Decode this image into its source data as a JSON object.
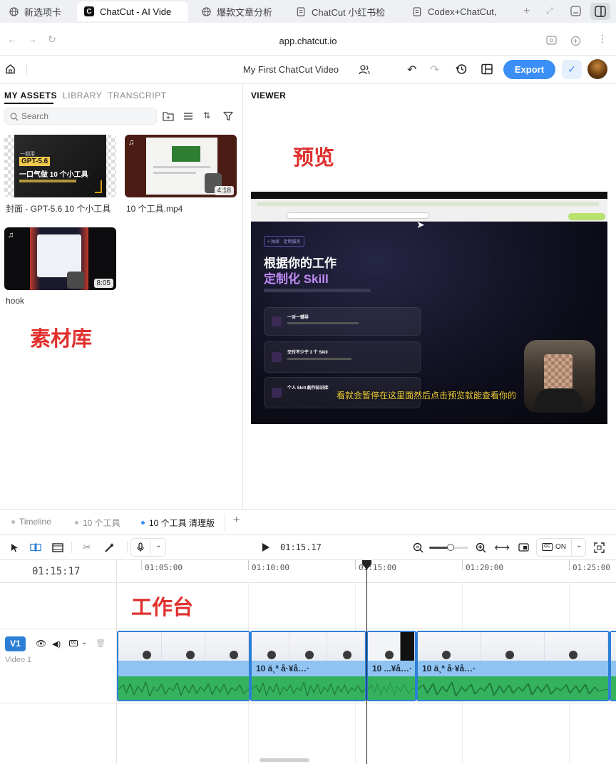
{
  "browser": {
    "tabs": [
      {
        "label": "新选项卡",
        "icon": "globe-icon"
      },
      {
        "label": "ChatCut - AI Vide",
        "icon": "chatcut-logo-icon"
      },
      {
        "label": "爆款文章分析",
        "icon": "globe-icon"
      },
      {
        "label": "ChatCut 小红书检",
        "icon": "document-icon"
      },
      {
        "label": "Codex+ChatCut,",
        "icon": "document-icon"
      }
    ],
    "url": "app.chatcut.io"
  },
  "app": {
    "project_title": "My First ChatCut Video",
    "export_label": "Export",
    "brand_color": "#3b8ef3"
  },
  "assets": {
    "tabs": [
      "MY ASSETS",
      "LIBRARY",
      "TRANSCRIPT"
    ],
    "search_placeholder": "Search",
    "items": [
      {
        "name": "封面 - GPT-5.6 10 个小工具",
        "overlay_title": "GPT-5.6",
        "overlay_sub": "一口气做 10 个小工具",
        "overlay_top": "一期用"
      },
      {
        "name": "10 个工具.mp4",
        "duration": "4:18"
      },
      {
        "name": "hook",
        "duration": "8:05"
      }
    ],
    "annotation": "素材库"
  },
  "viewer": {
    "label": "VIEWER",
    "annotation": "预览",
    "headline_1": "根据你的工作",
    "headline_2": "定制化 Skill",
    "subtitle": "看就会暂停在这里面然后点击预览就能查看你的",
    "cards": [
      "一对一辅导",
      "交付不少于 3 个 Skill",
      "个人 Skill 創作知识库"
    ],
    "pill": "+ 独家 · 定制服务"
  },
  "timeline": {
    "tabs": [
      "Timeline",
      "10 个工具",
      "10 个工具 清理版"
    ],
    "add_label": "+",
    "current_time": "01:15.17",
    "playhead_time": "01:15:17",
    "cc_label": "ON",
    "zoom_level": 0.55,
    "ruler": [
      "01:05:00",
      "01:10:00",
      "01:15:00",
      "01:20:00",
      "01:25:00"
    ],
    "annotation": "工作台",
    "track": {
      "badge": "V1",
      "name": "Video 1"
    },
    "clips": [
      {
        "label": ""
      },
      {
        "label": "10 ä¸ª å·¥å…·"
      },
      {
        "label": "10 ...¥å…·"
      },
      {
        "label": "10 ä¸ª å·¥å…·"
      },
      {
        "label": ""
      }
    ]
  }
}
